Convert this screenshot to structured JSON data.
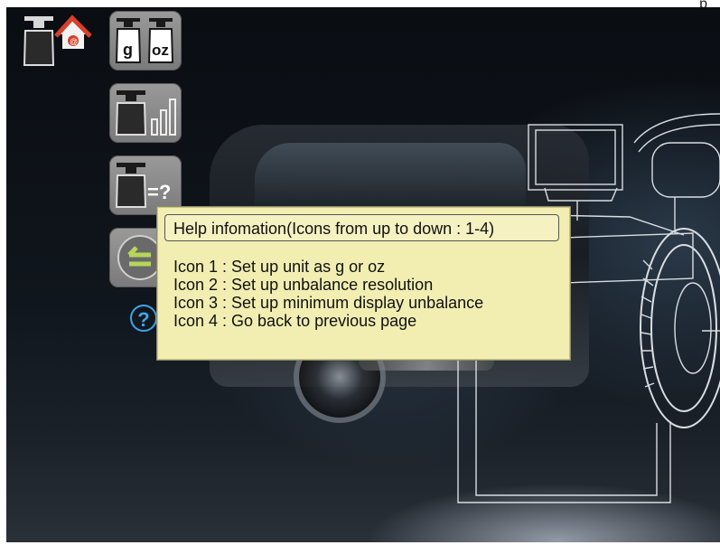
{
  "corner_mark": "p",
  "toolbar": {
    "unit_button": {
      "g_label": "g",
      "oz_label": "oz"
    },
    "resolution_button": {},
    "min_display_button": {
      "label": "=?"
    },
    "back_button": {}
  },
  "help": {
    "title": "Help infomation(Icons from up to down : 1-4)",
    "lines": [
      "Icon 1 : Set up unit as g or oz",
      "Icon 2 : Set up unbalance resolution",
      "Icon 3 : Set up minimum display unbalance",
      "Icon 4 : Go back to previous page"
    ],
    "icon_symbol": "?"
  },
  "colors": {
    "popup_background": "#f2eeb2",
    "button_gray": "#8a8a8a",
    "help_blue": "#3fa4e8",
    "home_red": "#d7402a"
  },
  "icons": [
    "weight-home-icon",
    "weight-g-oz-icon",
    "weight-resolution-icon",
    "weight-min-display-icon",
    "back-arrow-icon",
    "help-icon"
  ]
}
